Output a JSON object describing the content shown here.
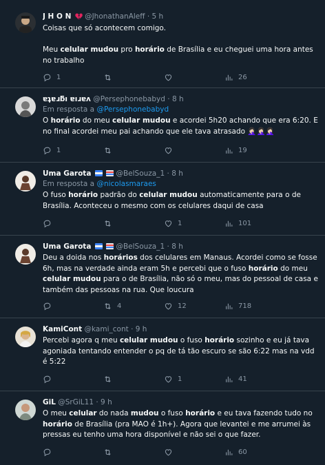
{
  "tweets": [
    {
      "name": "J H O N",
      "handle": "@JhonathanAleff",
      "time": "5 h",
      "reply_to_prefix": "",
      "reply_to_handle": "",
      "text_html": "Coisas que só acontecem comigo.<br><br>Meu <b>celular mudou</b> pro <b>horário</b> de Brasília e eu cheguei uma hora antes no trabalho",
      "replies": "1",
      "retweets": "",
      "likes": "",
      "views": "26"
    },
    {
      "name": "ɐʇɐɹƃı ɐıɹɐʌ",
      "handle": "@Persephonebabyd",
      "time": "8 h",
      "reply_to_prefix": "Em resposta a",
      "reply_to_handle": "@Persephonebabyd",
      "text_html": "O <b>horário</b> do meu <b>celular mudou</b> e acordei 5h20 achando que era 6:20. E no final acordei meu pai achando que ele tava atrasado 🤦🏻‍♀️🤦🏻‍♀️🤦🏻‍♀️",
      "replies": "1",
      "retweets": "",
      "likes": "",
      "views": "19"
    },
    {
      "name": "Uma Garota",
      "handle": "@BelSouza_1",
      "time": "8 h",
      "reply_to_prefix": "Em resposta a",
      "reply_to_handle": "@nicolasmaraes",
      "text_html": "O fuso <b>horário</b> padrão do <b>celular mudou</b> automaticamente para o de Brasília. Aconteceu o mesmo com os celulares daqui de casa",
      "replies": "",
      "retweets": "",
      "likes": "1",
      "views": "101"
    },
    {
      "name": "Uma Garota",
      "handle": "@BelSouza_1",
      "time": "8 h",
      "reply_to_prefix": "",
      "reply_to_handle": "",
      "text_html": "Deu a doida nos <b>horários</b> dos celulares em Manaus. Acordei como se fosse 6h, mas na verdade ainda eram 5h e percebi que o fuso <b>horário</b> do meu <b>celular mudou</b> para o de Brasília, não só o meu, mas do pessoal de casa e também das pessoas na rua. Que loucura",
      "replies": "",
      "retweets": "4",
      "likes": "12",
      "views": "718"
    },
    {
      "name": "KamiCont",
      "handle": "@kami_cont",
      "time": "9 h",
      "reply_to_prefix": "",
      "reply_to_handle": "",
      "text_html": "Percebi agora q meu <b>celular mudou</b> o fuso <b>horário</b> sozinho e eu já tava agoniada tentando entender o pq de tá tão escuro se são 6:22 mas na vdd é 5:22",
      "replies": "",
      "retweets": "",
      "likes": "1",
      "views": "41"
    },
    {
      "name": "GiL",
      "handle": "@SrGiL11",
      "time": "9 h",
      "reply_to_prefix": "",
      "reply_to_handle": "",
      "text_html": "O meu <b>celular</b> do nada <b>mudou</b> o fuso <b>horário</b> e eu tava fazendo tudo no <b>horário</b> de Brasília (pra MAO é 1h+). Agora que levantei e me arrumei às pressas eu tenho uma hora disponível e não sei o que fazer.",
      "replies": "",
      "retweets": "",
      "likes": "",
      "views": "60"
    }
  ],
  "separator": "·",
  "colors": {
    "background": "#15202b",
    "text": "#f7f9f9",
    "muted": "#8b98a5",
    "link": "#1d9bf0",
    "divider": "#38444d"
  },
  "icons": [
    "reply-icon",
    "retweet-icon",
    "like-icon",
    "views-icon",
    "broken-heart-icon"
  ]
}
